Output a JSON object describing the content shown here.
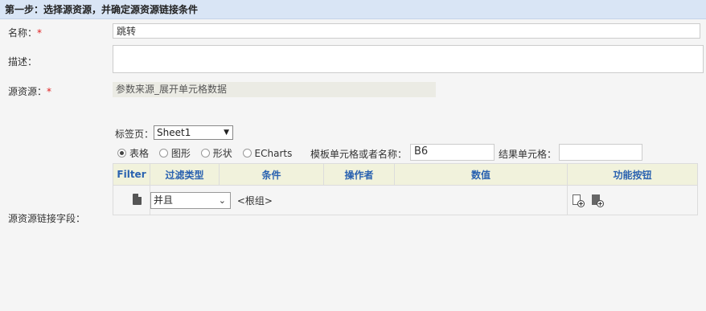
{
  "header": {
    "title": "第一步：选择源资源，并确定源资源链接条件"
  },
  "form": {
    "name_label": "名称：",
    "required_mark": "*",
    "name_value": "跳转",
    "desc_label": "描述：",
    "desc_value": "",
    "source_label": "源资源：",
    "source_value": "参数来源_展开单元格数据",
    "link_field_label": "源资源链接字段："
  },
  "link": {
    "sheet_label": "标签页：",
    "sheet_selected": "Sheet1",
    "radio_options": [
      "表格",
      "图形",
      "形状",
      "ECharts"
    ],
    "radio_checked": "表格",
    "template_cell_label": "模板单元格或者名称：",
    "template_cell_value": "B6",
    "result_cell_label": "结果单元格：",
    "result_cell_value": ""
  },
  "table": {
    "columns": [
      "Filter",
      "过滤类型",
      "条件",
      "操作者",
      "数值",
      "功能按钮"
    ],
    "rows": [
      {
        "filter_type": "并且",
        "condition": "<根组>"
      }
    ]
  }
}
